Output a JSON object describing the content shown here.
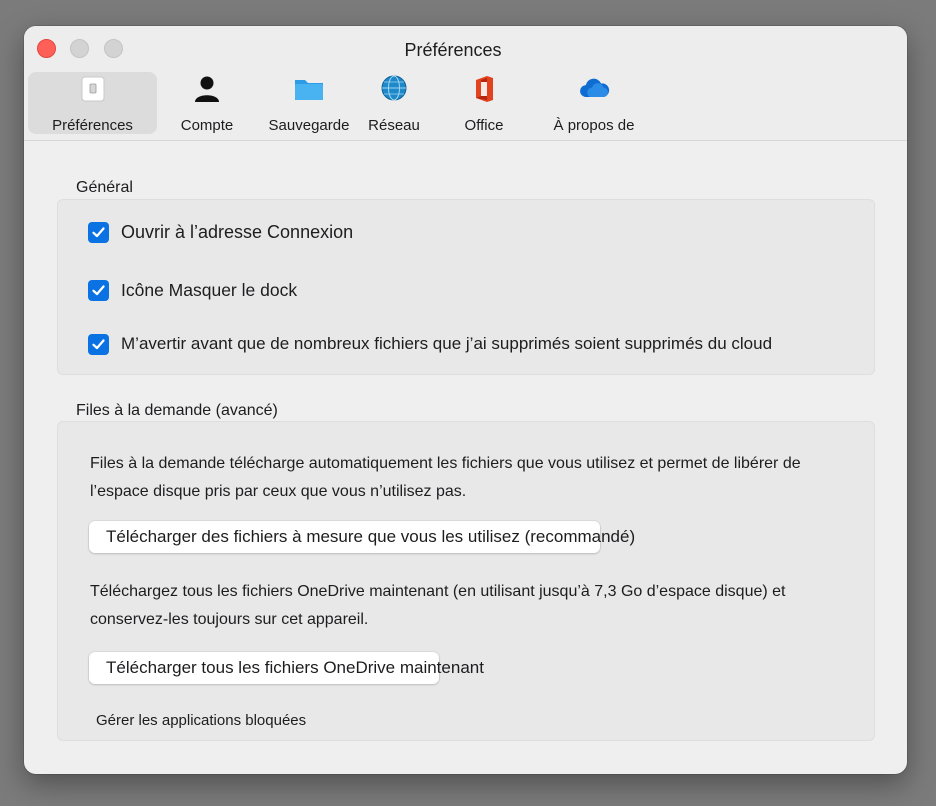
{
  "window": {
    "title": "Préférences"
  },
  "tabs": [
    {
      "label": "Préférences",
      "icon": "switch-icon",
      "selected": true
    },
    {
      "label": "Compte",
      "icon": "person-icon",
      "selected": false
    },
    {
      "label": "Sauvegarde",
      "icon": "folder-icon",
      "selected": false
    },
    {
      "label": "Réseau",
      "icon": "globe-icon",
      "selected": false
    },
    {
      "label": "Office",
      "icon": "office-icon",
      "selected": false
    },
    {
      "label": "À propos de",
      "icon": "cloud-icon",
      "selected": false
    }
  ],
  "general": {
    "title": "Général",
    "options": [
      {
        "label": "Ouvrir à l’adresse Connexion",
        "checked": true
      },
      {
        "label": "Icône Masquer le dock",
        "checked": true
      },
      {
        "label": "M’avertir avant que de nombreux fichiers que j’ai supprimés soient supprimés du cloud",
        "checked": true
      }
    ]
  },
  "files_on_demand": {
    "title": "Files à la demande (avancé)",
    "description_line1": "Files à la demande télécharge automatiquement les fichiers que vous utilisez et permet de libérer de",
    "description_line2": "l’espace disque pris par ceux que vous n’utilisez pas.",
    "download_on_use_button": "Télécharger des fichiers à mesure que vous les utilisez (recommandé)",
    "download_all_line1": "Téléchargez tous les fichiers OneDrive maintenant (en utilisant jusqu’à 7,3 Go d’espace disque) et",
    "download_all_line2": "conservez-les toujours sur cet appareil.",
    "download_all_button": "Télécharger tous les fichiers OneDrive maintenant",
    "manage_blocked_link": "Gérer les applications bloquées"
  },
  "colors": {
    "accent": "#0a72e3",
    "close": "#fe5f57",
    "window_bg": "#efefef",
    "panel_bg": "#e8e8e8"
  }
}
